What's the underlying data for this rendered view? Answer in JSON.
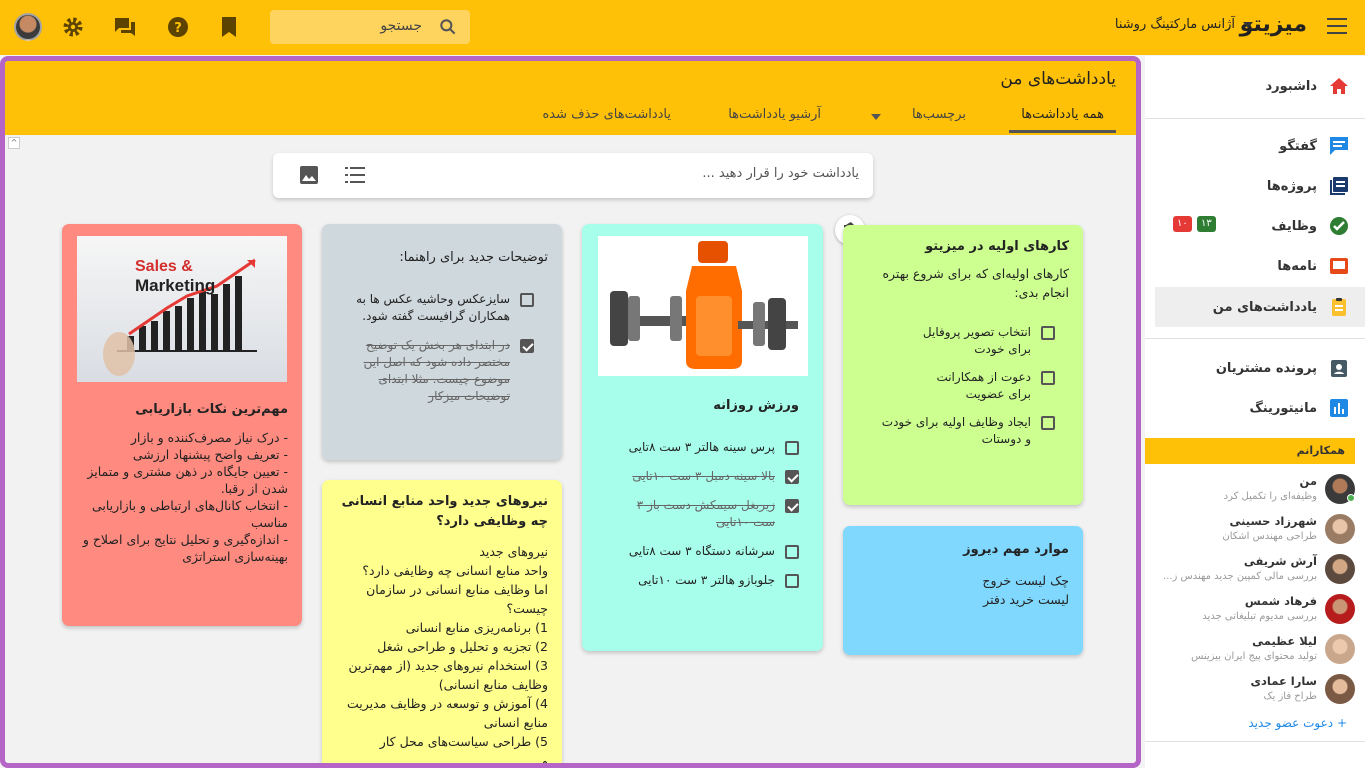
{
  "topbar": {
    "logo": "میزیتو",
    "org": "آژانس مارکتینگ روشنا",
    "search_placeholder": "جستجو",
    "accent": "#ffc107"
  },
  "page": {
    "title": "یادداشت‌های من",
    "tabs": [
      {
        "label": "همه یادداشت‌ها"
      },
      {
        "label": "برچسب‌ها"
      },
      {
        "label": "آرشیو یادداشت‌ها"
      },
      {
        "label": "یادداشت‌های حذف شده"
      }
    ],
    "composer_placeholder": "یادداشت خود را قرار دهید ..."
  },
  "notes": {
    "first_tasks": {
      "title": "کارهای اولیه در میزیتو",
      "text": "کارهای اولیه‌ای که برای شروع بهتره انجام بدی:",
      "items": [
        {
          "label": "انتخاب تصویر پروفایل برای خودت",
          "checked": false
        },
        {
          "label": "دعوت از همکارانت برای عضویت",
          "checked": false
        },
        {
          "label": "ایجاد وظایف اولیه برای خودت و دوستات",
          "checked": false
        }
      ],
      "color": "#ccff90"
    },
    "daily": {
      "title": "موارد مهم دیروز",
      "lines": [
        "چک لیست خروج",
        "لیست خرید دفتر"
      ],
      "color": "#80d8ff"
    },
    "workout": {
      "title": "ورزش روزانه",
      "items": [
        {
          "label": "پرس سینه هالتر ۳ ست ۸تایی",
          "checked": false
        },
        {
          "label": "بالا سینه دمبل ۳ ست ۱۰تایی",
          "checked": true
        },
        {
          "label": "زیربغل سیمکش دست باز ۳ ست ۱۰تایی",
          "checked": true
        },
        {
          "label": "سرشانه دستگاه ۳ ست ۸تایی",
          "checked": false
        },
        {
          "label": "جلوبازو هالتر ۳ ست ۱۰تایی",
          "checked": false
        }
      ],
      "color": "#a7ffeb"
    },
    "guide": {
      "title": "توضیحات جدید برای راهنما:",
      "items": [
        {
          "label": "سایزعکس وحاشیه عکس ها به همکاران گرافیست گفته شود.",
          "checked": false
        },
        {
          "label": "در ابتدای هر بخش یک توضیح مختصر داده شود که اصل این موضوع چیست. مثلا ابتدای توضیحات میزکار",
          "checked": true
        }
      ],
      "color": "#cfd8dc"
    },
    "hr": {
      "title": "نیروهای جدید واحد منابع انسانی چه وظایفی دارد؟",
      "lines": [
        "نیروهای جدید",
        "واحد منابع انسانی چه وظایفی دارد؟",
        "اما وظایف منابع انسانی در سازمان چیست؟",
        "1) برنامه‌ریزی منابع انسانی",
        "2) تجزیه و تحلیل و طراحی شغل",
        "3) استخدام نیروهای جدید (از مهم‌ترین وظایف منابع انسانی)",
        "4) آموزش و توسعه در وظایف مدیریت منابع انسانی",
        "5) طراحی سیاست‌های محل کار",
        "و ..."
      ],
      "color": "#ffff8d"
    },
    "marketing": {
      "title": "مهم‌ترین نکات بازاریابی",
      "image_line1": "Sales &",
      "image_line2": "Marketing",
      "lines": [
        "- درک نیاز مصرف‌کننده و بازار",
        "- تعریف واضح پیشنهاد ارزشی",
        "- تعیین جایگاه در ذهن مشتری و متمایز شدن از رقبا.",
        "- انتخاب کانال‌های ارتباطی و بازاریابی مناسب",
        "- اندازه‌گیری و تحلیل نتایج برای اصلاح و بهینه‌سازی استراتژی"
      ],
      "color": "#ff8a80"
    }
  },
  "sidebar": {
    "items": [
      {
        "label": "داشبورد"
      },
      {
        "label": "گفتگو"
      },
      {
        "label": "پروژه‌ها"
      },
      {
        "label": "وظایف",
        "badge_green": "۱۳",
        "badge_red": "۱۰"
      },
      {
        "label": "نامه‌ها"
      },
      {
        "label": "یادداشت‌های من"
      },
      {
        "label": "پرونده مشتریان"
      },
      {
        "label": "مانیتورینگ"
      }
    ],
    "colleagues_title": "همکارانم",
    "members": [
      {
        "name": "من",
        "desc": "وظیفه‌ای را تکمیل کرد"
      },
      {
        "name": "شهرزاد حسینی",
        "desc": "طراحی مهندس اشکان"
      },
      {
        "name": "آرش شریفی",
        "desc": "بررسی مالی کمپین جدید مهندس ز..."
      },
      {
        "name": "فرهاد شمس",
        "desc": "بررسی مدیوم تبلیغاتی جدید"
      },
      {
        "name": "لیلا عظیمی",
        "desc": "تولید محتوای پیج ایران بیزینس"
      },
      {
        "name": "سارا عمادی",
        "desc": "طراح فاز یک"
      }
    ],
    "invite": "+ دعوت عضو جدید"
  }
}
